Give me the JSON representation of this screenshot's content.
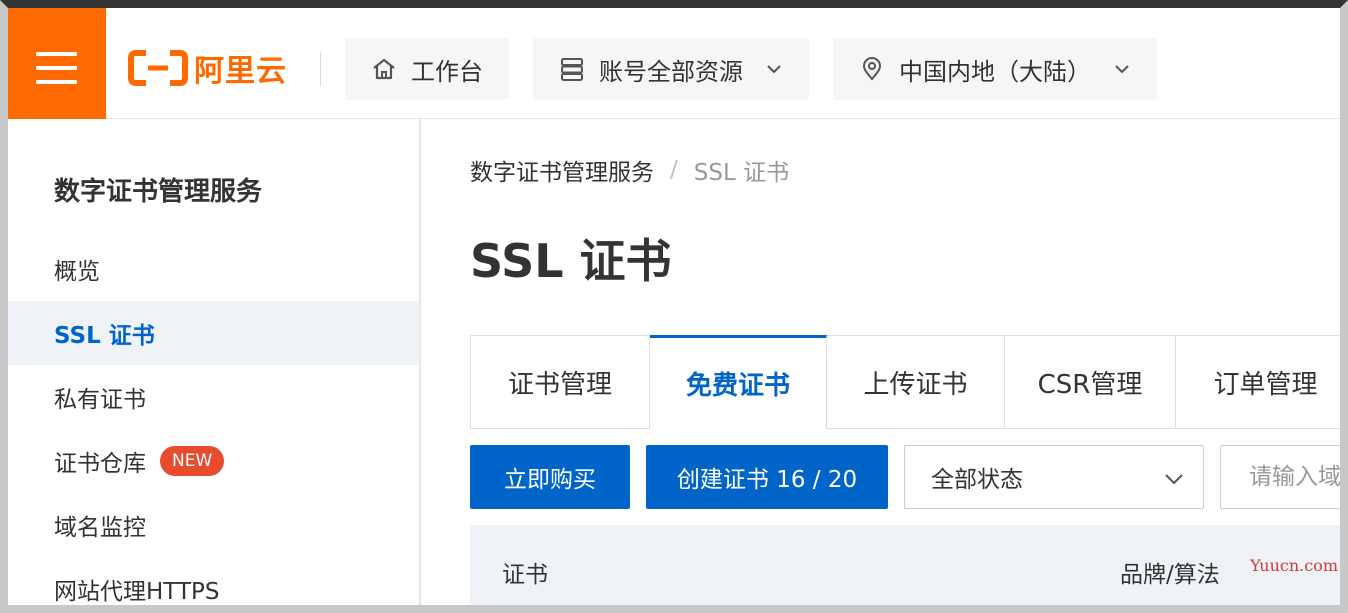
{
  "topbar": {
    "logo_text": "阿里云",
    "workbench_label": "工作台",
    "resources_label": "账号全部资源",
    "region_label": "中国内地（大陆）"
  },
  "sidebar": {
    "title": "数字证书管理服务",
    "items": [
      {
        "label": "概览"
      },
      {
        "label": "SSL 证书"
      },
      {
        "label": "私有证书"
      },
      {
        "label": "证书仓库",
        "badge": "NEW"
      },
      {
        "label": "域名监控"
      },
      {
        "label": "网站代理HTTPS"
      }
    ]
  },
  "breadcrumb": {
    "root": "数字证书管理服务",
    "separator": "/",
    "current": "SSL 证书"
  },
  "page": {
    "title": "SSL 证书"
  },
  "tabs": [
    {
      "label": "证书管理"
    },
    {
      "label": "免费证书"
    },
    {
      "label": "上传证书"
    },
    {
      "label": "CSR管理"
    },
    {
      "label": "订单管理"
    }
  ],
  "toolbar": {
    "buy_label": "立即购买",
    "create_label": "创建证书 16 / 20",
    "status_select_value": "全部状态",
    "search_placeholder": "请输入域名"
  },
  "table": {
    "columns": [
      "证书",
      "品牌/算法"
    ]
  },
  "watermark": "Yuucn.com",
  "colors": {
    "brand_orange": "#ff6a00",
    "primary_blue": "#0064c8",
    "badge_red": "#e84c2e"
  }
}
